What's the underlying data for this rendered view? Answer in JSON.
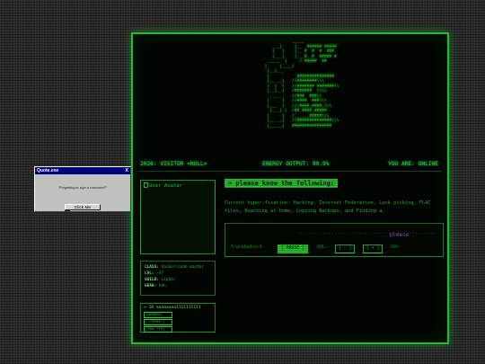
{
  "ascii_art": "                 _____\n         ___|     |__  ###### #####\n         |   |    |__ #  #  #  ###\n         |___|    |___#. #  ##### #\n       _____  |     / #####  ##\n      |     |____/\n       |__|___\n       |           ###############\n       |__ __|   //########\\\\\\\n       /  |  \\   //####### #######\\\\\n       |__|__|   /#######  \\\\\\\\\n        ______   //###  ###\\\\\n       |     |   //####  ###\\\\\\\n       |___  |   ///####_####_\\\\\\\n        |___| |  /##_####_#####\n       |     |   /______#####\\\\\\\n       |__ __|   //##############\\\\\\\n       |_____|   ################",
  "status": {
    "left": "2026: VISITOR <NULL>",
    "middle": "ENERGY OUTPUT: 99.9%",
    "right": "YOU ARE: ONLINE"
  },
  "avatar": {
    "alt": "User Avatar"
  },
  "stats": {
    "class_label": "CLASS:",
    "class_value": "hacker/code master",
    "lvl_label": "LVL:",
    "lvl_value": "-47",
    "guild_label": "GUILD:",
    "guild_value": "cipher",
    "gear_label": "GEAR:",
    "gear_value": "hhh"
  },
  "log": {
    "line": "> 18 aaaaaaaa1111111111",
    "buttons": [
      "[ANSWERS]",
      "[ CIPHER ]",
      "[TOOL TIP]"
    ]
  },
  "heading": "> please know the following:",
  "fixation": "Current hyper-fixation: Hacking, Internet Federation, Lock picking, FLAC files, Reaching at home, Copying Backups, and Finding a.",
  "player": {
    "dots": "..............................................",
    "marquee_a": "....",
    "marquee_b": "please",
    "marquee_c": "...",
    "trackradio": "TrackRadio:9",
    "pause": "[ PAUSE ]",
    "vol": "VOL:",
    "vol_down": "[ - ]",
    "vol_up": "[ + ]",
    "volume_level": "50%"
  },
  "popup": {
    "title": "Quote.exe",
    "close": "X",
    "message": "\"Forgetting to sign a comment?\"",
    "button": "Click Me"
  }
}
